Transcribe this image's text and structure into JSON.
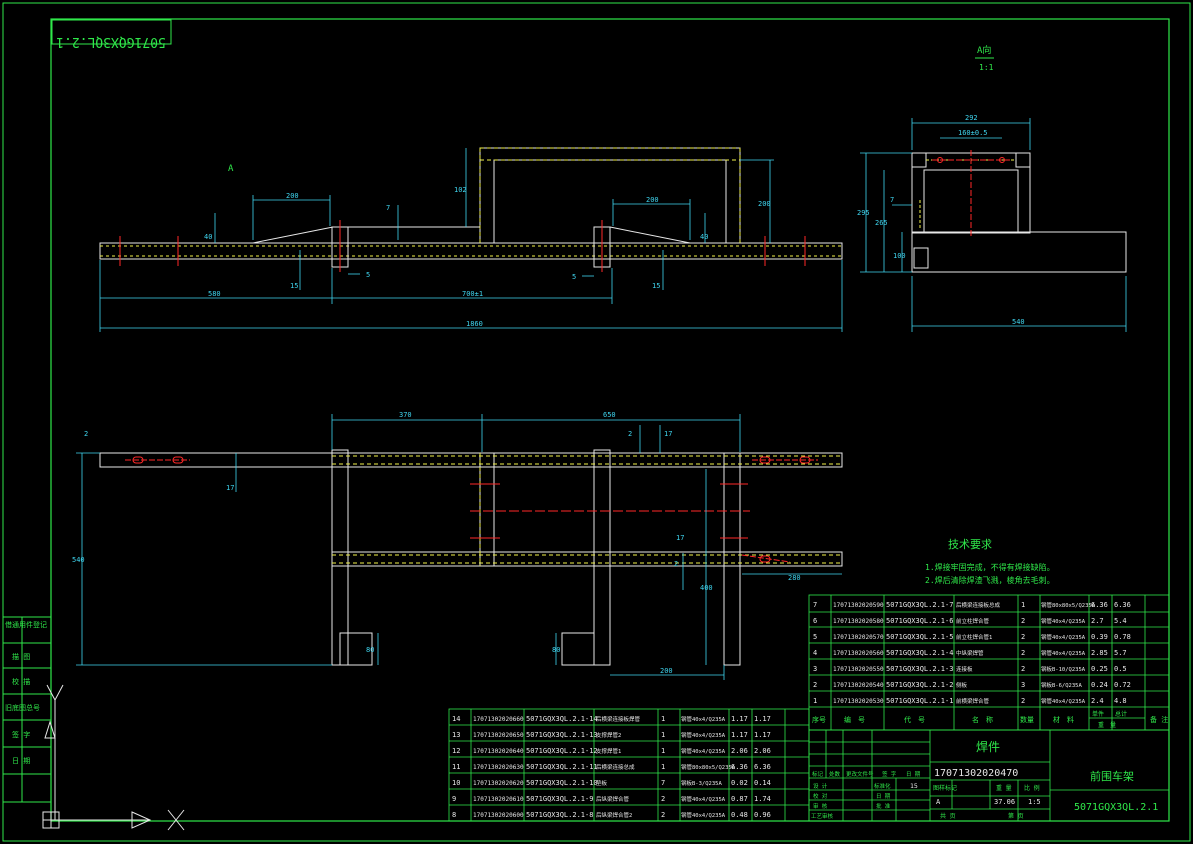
{
  "drawing_number_stamp": "5071GQX3QL.2.1",
  "view_labels": {
    "section": "A向",
    "scale": "1:1",
    "arrow": "A"
  },
  "dims_front": {
    "d200_left": "200",
    "d200_right": "200",
    "d7_a": "7",
    "d7_b": "7",
    "d5_left": "5",
    "d5_right": "5",
    "d15_left": "15",
    "d15_right": "15",
    "d40_left": "40",
    "d40_right": "40",
    "d102": "102",
    "d200_v": "200",
    "d580": "580",
    "d700": "700±1",
    "d1860": "1860"
  },
  "dims_side": {
    "d292": "292",
    "d160": "160±0.5",
    "d295": "295",
    "d265": "265",
    "d100": "100",
    "d7": "7",
    "d540": "540"
  },
  "dims_plan": {
    "d370": "370",
    "d650": "650",
    "d540": "540",
    "d2": "2",
    "d17a": "17",
    "d17b": "17",
    "d17c": "17",
    "d2b": "2",
    "d2c": "2",
    "d280": "280",
    "d400": "400",
    "d200": "200",
    "d80a": "80",
    "d80b": "80"
  },
  "tech_req": {
    "title": "技术要求",
    "items": [
      "1.焊接牢固完成，不得有焊接缺陷。",
      "2.焊后清除焊渣飞溅，棱角去毛刺。"
    ]
  },
  "bom_right": [
    {
      "no": "7",
      "code": "17071302020590",
      "drawing": "5071GQX3QL.2.1-7",
      "name": "后横梁连接板总成",
      "qty": "1",
      "mat": "钢管80x80x5/Q235A",
      "unit": "6.36",
      "total": "6.36"
    },
    {
      "no": "6",
      "code": "17071302020580",
      "drawing": "5071GQX3QL.2.1-6",
      "name": "前立柱焊合管",
      "qty": "2",
      "mat": "钢管40x4/Q235A",
      "unit": "2.7",
      "total": "5.4"
    },
    {
      "no": "5",
      "code": "17071302020570",
      "drawing": "5071GQX3QL.2.1-5",
      "name": "前立柱焊合管1",
      "qty": "2",
      "mat": "钢管40x4/Q235A",
      "unit": "0.39",
      "total": "0.78"
    },
    {
      "no": "4",
      "code": "17071302020560",
      "drawing": "5071GQX3QL.2.1-4",
      "name": "中纵梁焊管",
      "qty": "2",
      "mat": "钢管40x4/Q235A",
      "unit": "2.85",
      "total": "5.7"
    },
    {
      "no": "3",
      "code": "17071302020550",
      "drawing": "5071GQX3QL.2.1-3",
      "name": "连接板",
      "qty": "2",
      "mat": "钢板B-10/Q235A",
      "unit": "0.25",
      "total": "0.5"
    },
    {
      "no": "2",
      "code": "17071302020540",
      "drawing": "5071GQX3QL.2.1-2",
      "name": "侧板",
      "qty": "3",
      "mat": "钢板B-6/Q235A",
      "unit": "0.24",
      "total": "0.72"
    },
    {
      "no": "1",
      "code": "17071302020530",
      "drawing": "5071GQX3QL.2.1-1",
      "name": "前横梁焊合管",
      "qty": "2",
      "mat": "钢管40x4/Q235A",
      "unit": "2.4",
      "total": "4.8"
    }
  ],
  "bom_header": [
    "序号",
    "编　号",
    "代　号",
    "名　称",
    "数量",
    "材　料",
    "单件",
    "总计",
    "备 注"
  ],
  "bom_header_sub": "重　量",
  "bom_left": [
    {
      "no": "14",
      "code": "17071302020660",
      "drawing": "5071GQX3QL.2.1-14",
      "name": "后横梁连接板焊管",
      "qty": "1",
      "mat": "钢管40x4/Q235A",
      "unit": "1.17",
      "total": "1.17"
    },
    {
      "no": "13",
      "code": "17071302020650",
      "drawing": "5071GQX3QL.2.1-13",
      "name": "支撑焊管2",
      "qty": "1",
      "mat": "钢管40x4/Q235A",
      "unit": "1.17",
      "total": "1.17"
    },
    {
      "no": "12",
      "code": "17071302020640",
      "drawing": "5071GQX3QL.2.1-12",
      "name": "支撑焊管1",
      "qty": "1",
      "mat": "钢管40x4/Q235A",
      "unit": "2.06",
      "total": "2.06"
    },
    {
      "no": "11",
      "code": "17071302020630",
      "drawing": "5071GQX3QL.2.1-11",
      "name": "后横梁连接总成",
      "qty": "1",
      "mat": "钢管80x80x5/Q235A",
      "unit": "6.36",
      "total": "6.36"
    },
    {
      "no": "10",
      "code": "17071302020620",
      "drawing": "5071GQX3QL.2.1-10",
      "name": "垫板",
      "qty": "7",
      "mat": "钢板B-3/Q235A",
      "unit": "0.02",
      "total": "0.14"
    },
    {
      "no": "9",
      "code": "17071302020610",
      "drawing": "5071GQX3QL.2.1-9",
      "name": "后纵梁焊合管",
      "qty": "2",
      "mat": "钢管40x4/Q235A",
      "unit": "0.87",
      "total": "1.74"
    },
    {
      "no": "8",
      "code": "17071302020600",
      "drawing": "5071GQX3QL.2.1-8",
      "name": "后纵梁焊合管2",
      "qty": "2",
      "mat": "钢管40x4/Q235A",
      "unit": "0.48",
      "total": "0.96"
    }
  ],
  "title_block": {
    "type": "焊件",
    "code": "17071302020470",
    "name": "前围车架",
    "drawing_no": "5071GQX3QL.2.1",
    "weight": "37.06",
    "scale": "1:5",
    "stage": "A",
    "row_labels": [
      "标记",
      "处数",
      "更改文件号",
      "签 字",
      "日 期"
    ],
    "role_labels": [
      "设 计",
      "校 对",
      "审 核",
      "工艺审核"
    ],
    "field_labels": [
      "标准化",
      "批 准",
      "图样标记",
      "重 量",
      "比 例",
      "共 页",
      "第 页",
      "日 期"
    ],
    "sheets": "15"
  },
  "left_strip": [
    "借通用件登记",
    "描 图",
    "校 描",
    "旧底图总号",
    "签 字",
    "日 期"
  ],
  "colors": {
    "frame": "#2fe84a",
    "part": "#e8e8e8",
    "dim": "#3fd6f0",
    "weld": "#f2f24a",
    "center": "#ff2828"
  }
}
